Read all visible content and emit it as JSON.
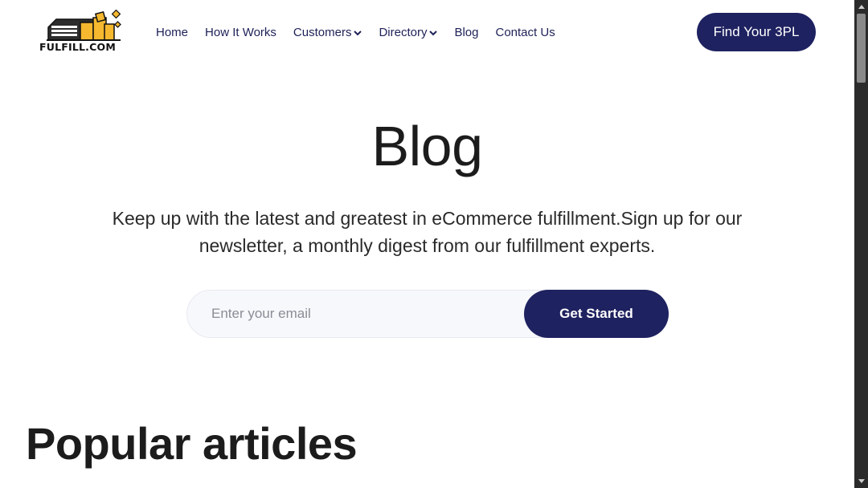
{
  "header": {
    "logo_text": "FULFILL.COM",
    "nav": [
      {
        "label": "Home",
        "has_dropdown": false
      },
      {
        "label": "How It Works",
        "has_dropdown": false
      },
      {
        "label": "Customers",
        "has_dropdown": true
      },
      {
        "label": "Directory",
        "has_dropdown": true
      },
      {
        "label": "Blog",
        "has_dropdown": false
      },
      {
        "label": "Contact Us",
        "has_dropdown": false
      }
    ],
    "cta_label": "Find Your 3PL"
  },
  "hero": {
    "title": "Blog",
    "description": "Keep up with the latest and greatest in eCommerce fulfillment.Sign up for our newsletter, a monthly digest from our fulfillment experts.",
    "email_placeholder": "Enter your email",
    "email_value": "",
    "submit_label": "Get Started"
  },
  "popular": {
    "title": "Popular articles"
  },
  "colors": {
    "brand_navy": "#1f2260",
    "logo_yellow": "#f5b82e"
  },
  "icons": {
    "nav_dropdown": "chevron-down-icon",
    "scroll_up": "triangle-up-icon",
    "scroll_down": "triangle-down-icon"
  }
}
